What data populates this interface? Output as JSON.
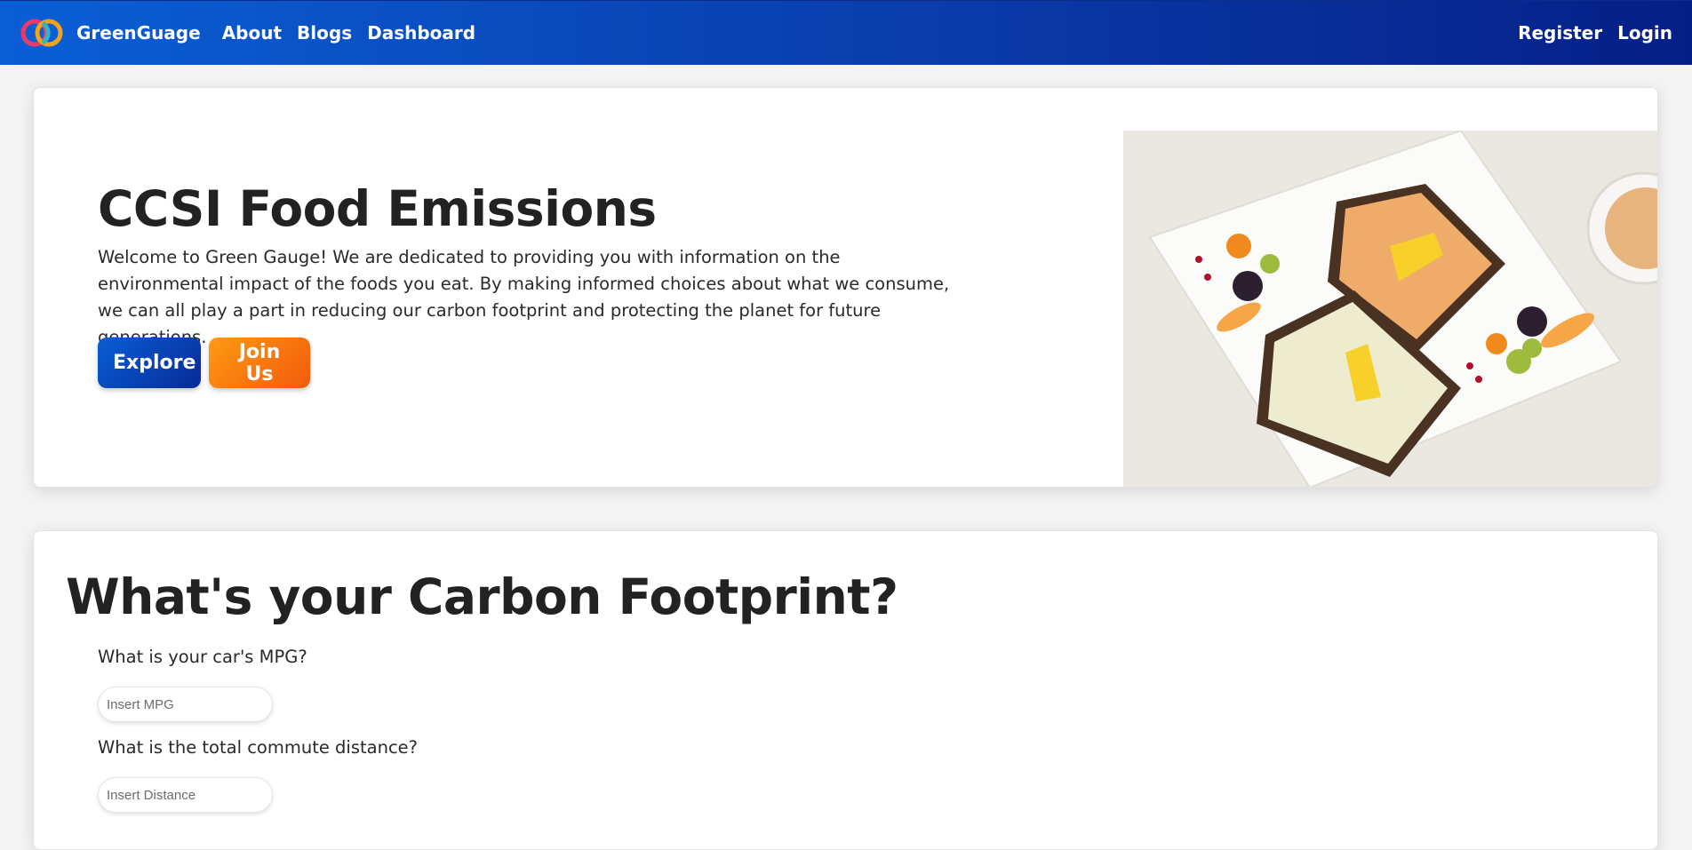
{
  "navbar": {
    "brand": "GreenGuage",
    "links": [
      "About",
      "Blogs",
      "Dashboard"
    ],
    "right_links": [
      "Register",
      "Login"
    ]
  },
  "hero": {
    "title": "CCSI Food Emissions",
    "text": "Welcome to Green Gauge! We are dedicated to providing you with information on the environmental impact of the foods you eat. By making informed choices about what we consume, we can all play a part in reducing our carbon footprint and protecting the planet for future generations.",
    "explore_label": "Explore",
    "join_label": "Join Us"
  },
  "carbon": {
    "title": "What's your Carbon Footprint?",
    "questions": [
      {
        "label": "What is your car's MPG?",
        "placeholder": "Insert MPG"
      },
      {
        "label": "What is the total commute distance?",
        "placeholder": "Insert Distance"
      }
    ]
  },
  "colors": {
    "nav_start": "#0a5fd6",
    "nav_end": "#061f86",
    "explore": "#0a4fc4",
    "join": "#f57a0f"
  }
}
